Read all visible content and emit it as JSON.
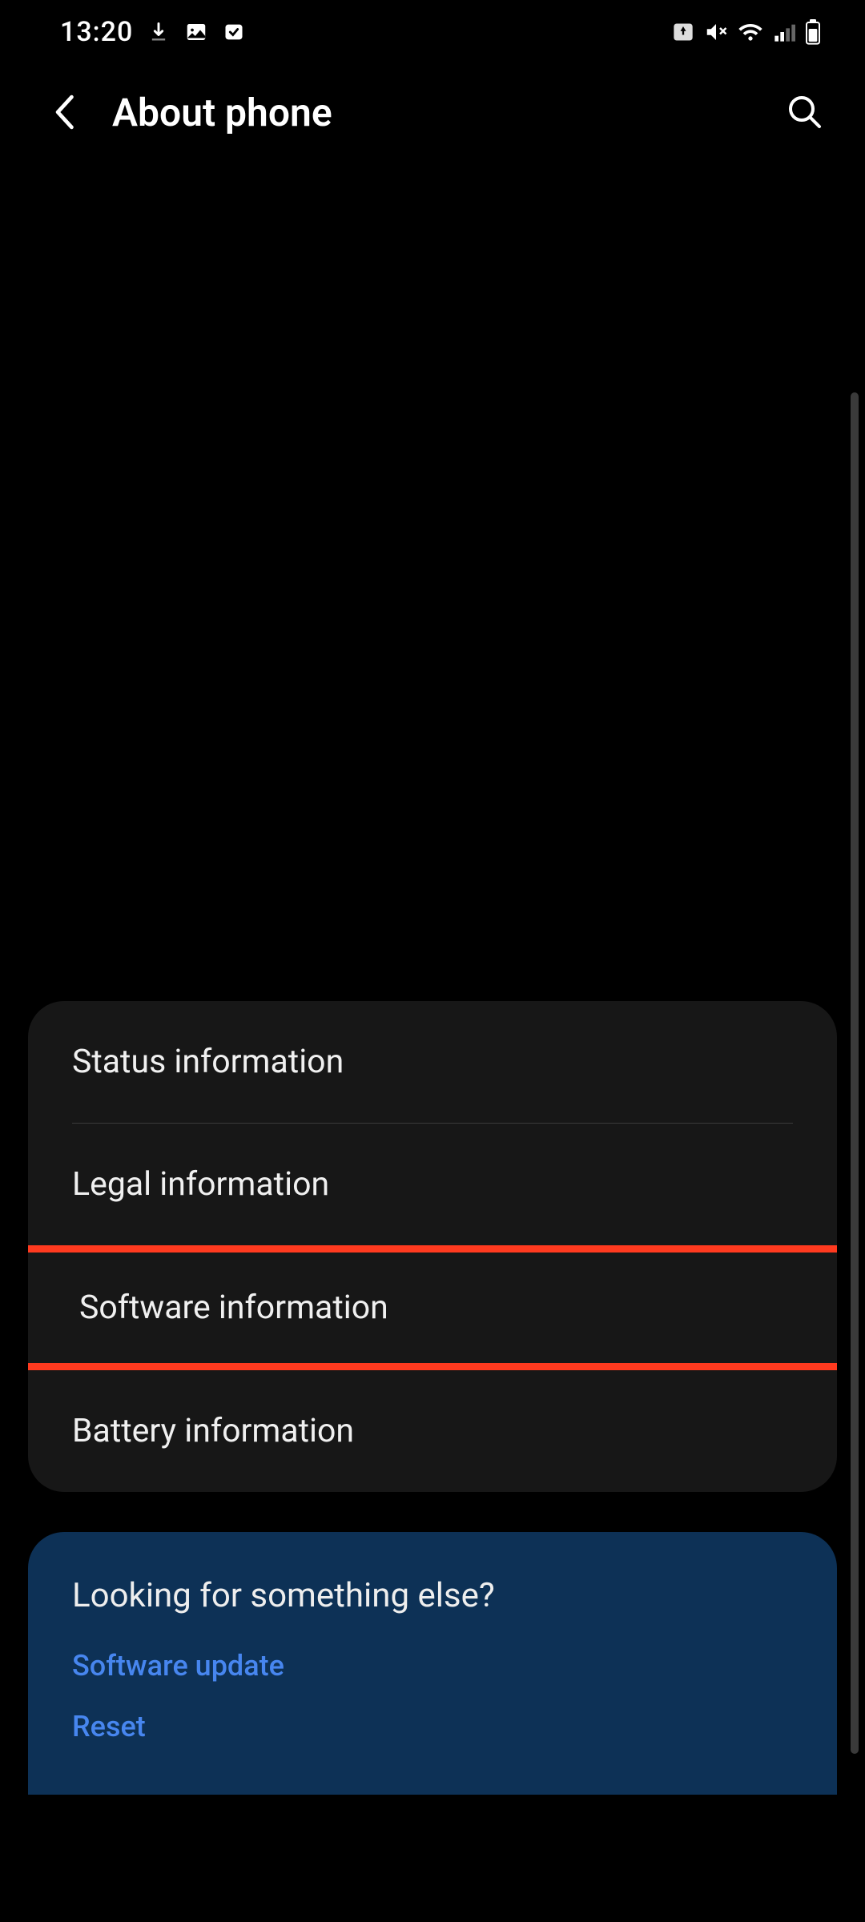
{
  "status": {
    "time": "13:20"
  },
  "header": {
    "title": "About phone"
  },
  "list": {
    "items": [
      "Status information",
      "Legal information",
      "Software information",
      "Battery information"
    ]
  },
  "footer": {
    "title": "Looking for something else?",
    "links": [
      "Software update",
      "Reset"
    ]
  },
  "highlight": {
    "color": "#ff3a1f",
    "index": 2
  }
}
